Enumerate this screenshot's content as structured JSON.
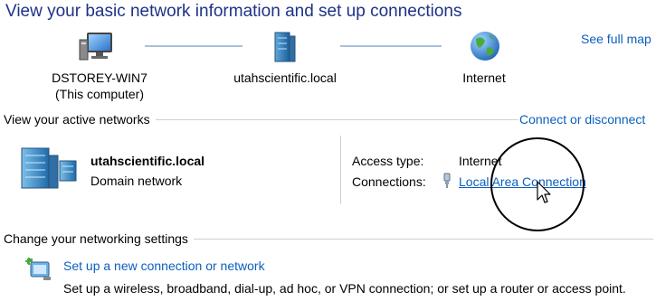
{
  "header": {
    "title": "View your basic network information and set up connections",
    "see_full_map": "See full map"
  },
  "network_map": {
    "computer": {
      "name": "DSTOREY-WIN7",
      "sub": "(This computer)",
      "icon": "computer-icon"
    },
    "domain": {
      "name": "utahscientific.local",
      "icon": "server-icon"
    },
    "internet": {
      "name": "Internet",
      "icon": "globe-icon"
    }
  },
  "active_networks": {
    "section_title": "View your active networks",
    "connect_link": "Connect or disconnect",
    "network_name": "utahscientific.local",
    "network_type": "Domain network",
    "access_type_label": "Access type:",
    "access_type_value": "Internet",
    "connections_label": "Connections:",
    "connection_link": "Local Area Connection"
  },
  "settings": {
    "section_title": "Change your networking settings",
    "task_title": "Set up a new connection or network",
    "task_desc": "Set up a wireless, broadband, dial-up, ad hoc, or VPN connection; or set up a router or access point."
  },
  "colors": {
    "title": "#1e3287",
    "link": "#0b5fbd",
    "line": "#a9c1dd"
  }
}
